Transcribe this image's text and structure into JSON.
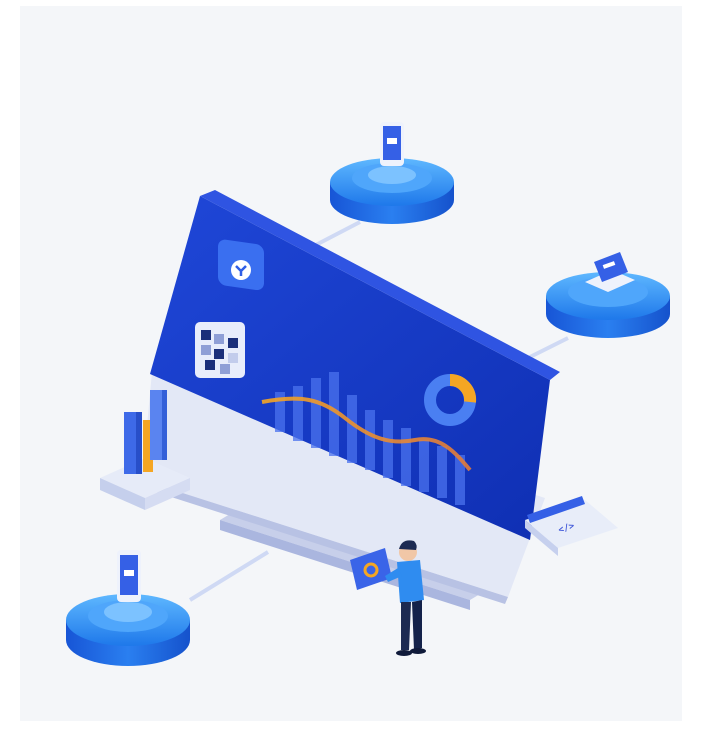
{
  "illustration": {
    "description_name": "isometric-monitor-illustration",
    "colors": {
      "background": "#f4f6f9",
      "screen": "#1a3bd4",
      "screen_dark": "#1230b8",
      "platform_top": "#2f8cf0",
      "platform_side": "#1f63e0",
      "accent_orange": "#f5a623",
      "link": "#c9d6f5"
    },
    "code_tag": "</>"
  }
}
